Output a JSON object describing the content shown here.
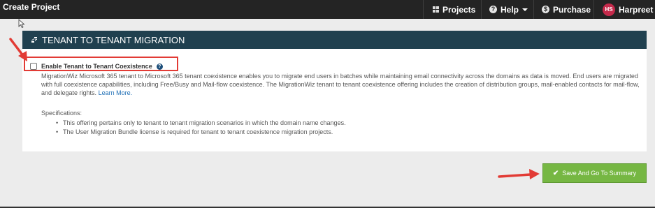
{
  "navbar": {
    "title": "Create Project",
    "items": [
      {
        "label": "Projects",
        "icon": "grid-icon"
      },
      {
        "label": "Help",
        "icon": "question-circle-icon"
      },
      {
        "label": "Purchase",
        "icon": "dollar-circle-icon"
      }
    ],
    "user": {
      "initials": "HS",
      "name": "Harpreet S"
    }
  },
  "panel": {
    "title": "TENANT TO TENANT MIGRATION",
    "checkbox": {
      "label": "Enable Tenant to Tenant Coexistence",
      "checked": false
    },
    "description": "MigrationWiz Microsoft 365 tenant to Microsoft 365 tenant coexistence enables you to migrate end users in batches while maintaining email connectivity across the domains as data is moved. End users are migrated with full coexistence capabilities, including Free/Busy and Mail-flow coexistence. The MigrationWiz tenant to tenant coexistence offering includes the creation of distribution groups, mail-enabled contacts for mail-flow, and delegate rights.",
    "learn_more": "Learn More.",
    "specifications_title": "Specifications:",
    "specifications": [
      "This offering pertains only to tenant to tenant migration scenarios in which the domain name changes.",
      "The User Migration Bundle license is required for tenant to tenant coexistence migration projects."
    ]
  },
  "actions": {
    "save_label": "Save And Go To Summary"
  },
  "colors": {
    "navbar": "#242424",
    "panel_header": "#20404f",
    "save": "#76b743",
    "annotation": "#e23b35",
    "link": "#1f6fb5"
  }
}
